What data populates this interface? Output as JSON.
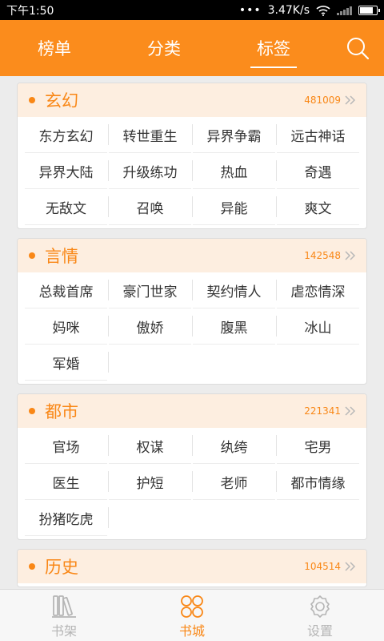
{
  "status": {
    "time": "下午1:50",
    "dots": "•••",
    "speed": "3.47K/s",
    "battery_level": 0.85
  },
  "top_tabs": [
    {
      "label": "榜单",
      "active": false
    },
    {
      "label": "分类",
      "active": false
    },
    {
      "label": "标签",
      "active": true
    }
  ],
  "sections": [
    {
      "title": "玄幻",
      "count": "481009",
      "tags": [
        "东方玄幻",
        "转世重生",
        "异界争霸",
        "远古神话",
        "异界大陆",
        "升级练功",
        "热血",
        "奇遇",
        "无敌文",
        "召唤",
        "异能",
        "爽文"
      ]
    },
    {
      "title": "言情",
      "count": "142548",
      "tags": [
        "总裁首席",
        "豪门世家",
        "契约情人",
        "虐恋情深",
        "妈咪",
        "傲娇",
        "腹黑",
        "冰山",
        "军婚"
      ]
    },
    {
      "title": "都市",
      "count": "221341",
      "tags": [
        "官场",
        "权谋",
        "纨绔",
        "宅男",
        "医生",
        "护短",
        "老师",
        "都市情缘",
        "扮猪吃虎"
      ]
    },
    {
      "title": "历史",
      "count": "104514",
      "tags": []
    }
  ],
  "bottom_nav": [
    {
      "label": "书架",
      "icon": "bookshelf-icon",
      "active": false
    },
    {
      "label": "书城",
      "icon": "bookstore-icon",
      "active": true
    },
    {
      "label": "设置",
      "icon": "settings-icon",
      "active": false
    }
  ],
  "colors": {
    "accent": "#fb8c1c",
    "inactive": "#b5b5b5",
    "section_head_bg": "#fdeee0"
  }
}
